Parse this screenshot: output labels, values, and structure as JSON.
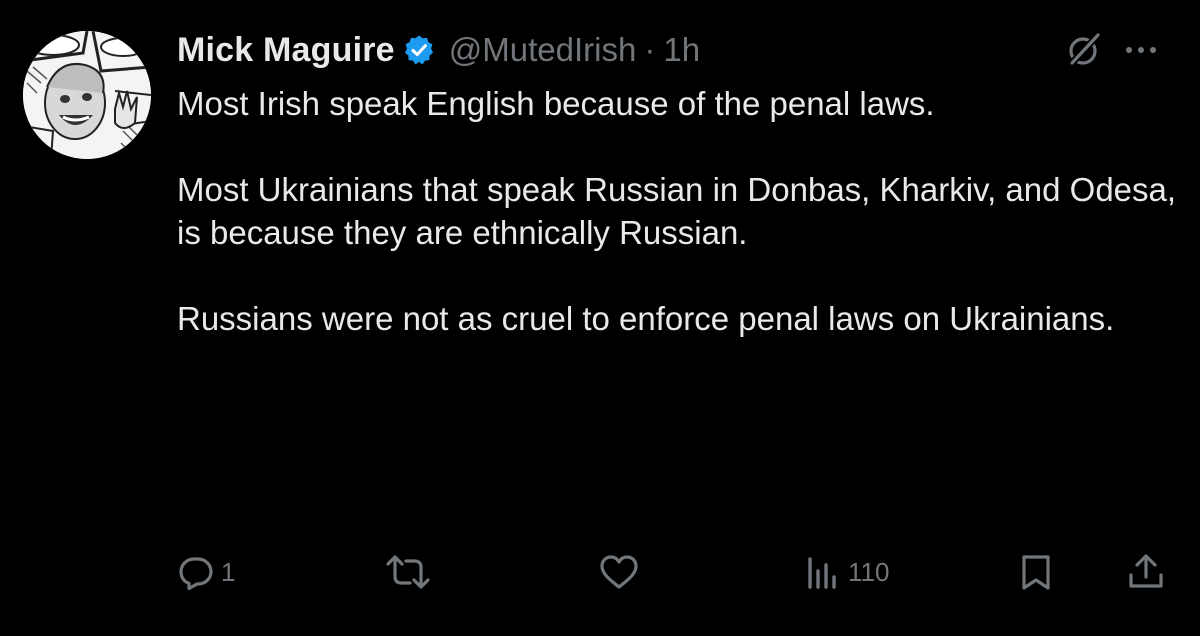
{
  "author": {
    "display_name": "Mick Maguire",
    "handle": "@MutedIrish",
    "time": "1h",
    "separator": "·",
    "verified": true
  },
  "tweet": {
    "paragraphs": [
      "Most Irish speak English because of the penal laws.",
      "Most Ukrainians that speak Russian in Donbas, Kharkiv, and Odesa, is because they are ethnically Russian.",
      "Russians were not as cruel to enforce penal laws on Ukrainians."
    ]
  },
  "actions": {
    "reply_count": "1",
    "repost_count": "",
    "like_count": "",
    "views_count": "110"
  },
  "icons": {
    "verified": "verified-badge-icon",
    "grok": "grok-icon",
    "more": "more-icon",
    "reply": "reply-icon",
    "repost": "repost-icon",
    "like": "heart-icon",
    "views": "views-icon",
    "bookmark": "bookmark-icon",
    "share": "share-icon"
  },
  "colors": {
    "background": "#000000",
    "text_primary": "#e7e9ea",
    "text_secondary": "#71767b",
    "verified_blue": "#1d9bf0"
  }
}
